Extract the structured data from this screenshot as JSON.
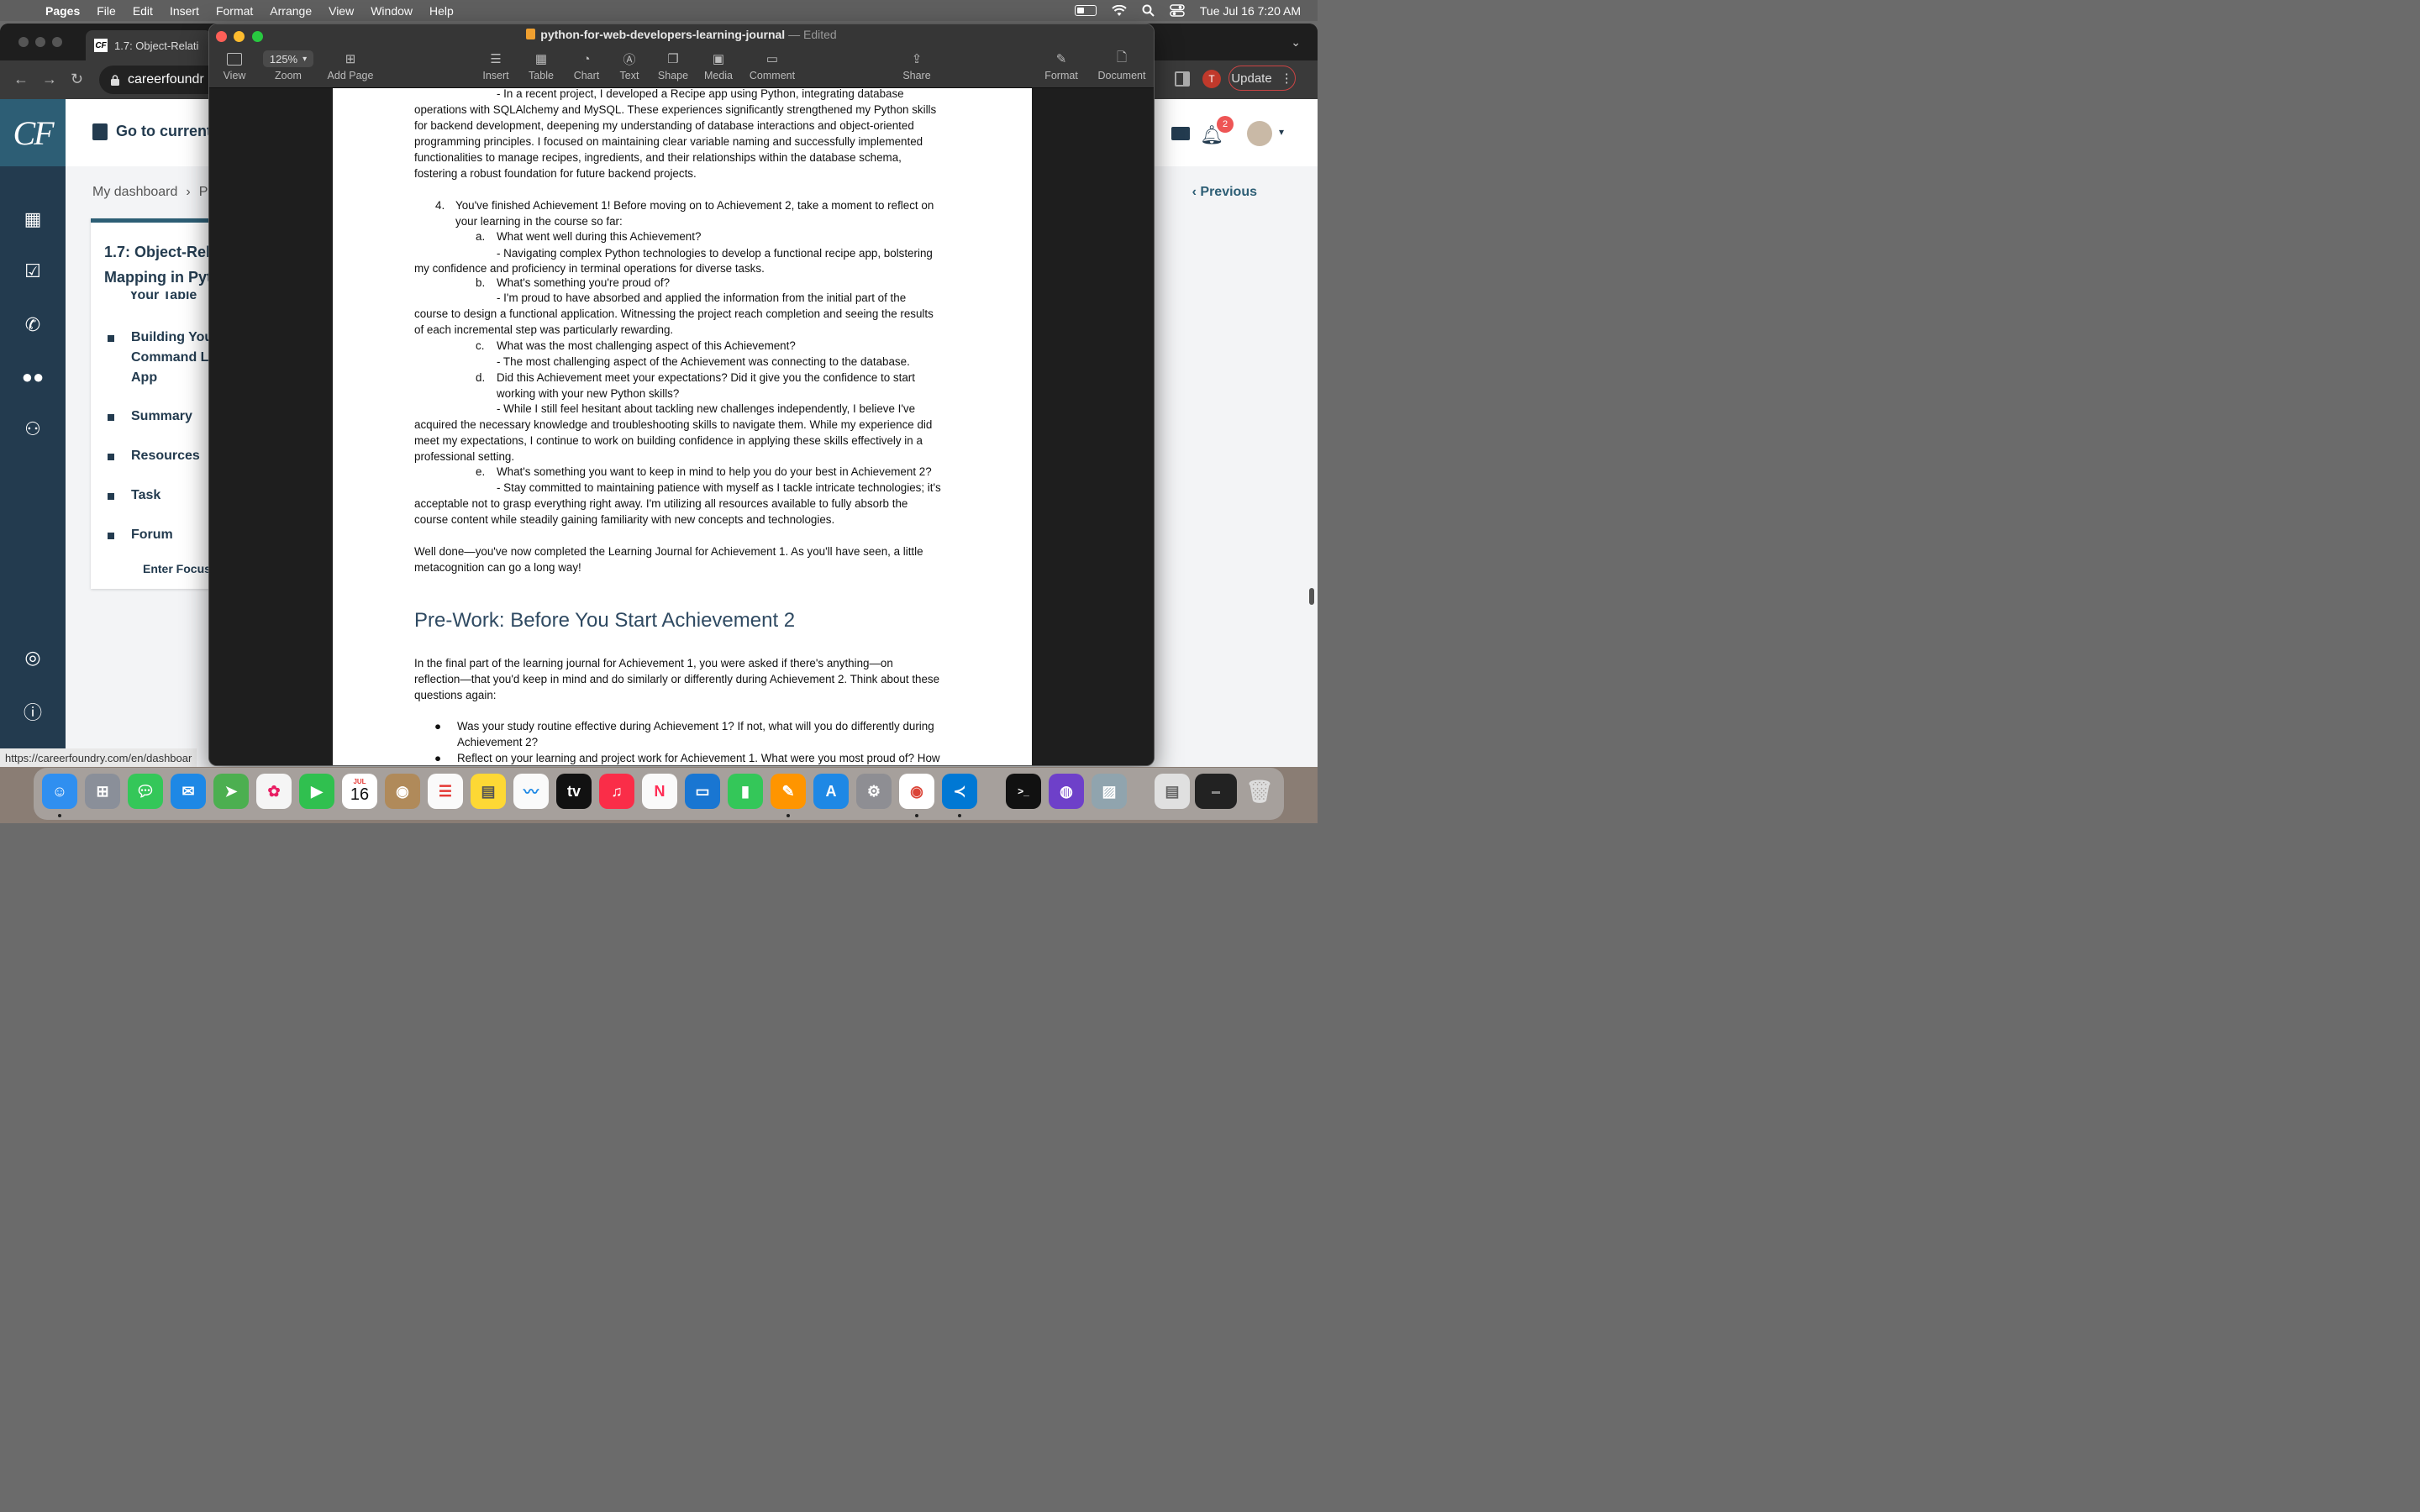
{
  "menubar": {
    "app": "Pages",
    "items": [
      "File",
      "Edit",
      "Insert",
      "Format",
      "Arrange",
      "View",
      "Window",
      "Help"
    ],
    "clock": "Tue Jul 16  7:20 AM"
  },
  "browser": {
    "tab_title": "1.7: Object-Relati",
    "url": "careerfoundr",
    "update_label": "Update",
    "avatar_initial": "T",
    "status_url": "https://careerfoundry.com/en/dashboar",
    "logo": "CF",
    "go_current": "Go to current",
    "notif_count": "2",
    "breadcrumb_root": "My dashboard",
    "breadcrumb_next": "P",
    "previous_label": "Previous",
    "card_title_1": "1.7: Object-Rela",
    "card_title_2": "Mapping in Pyth",
    "toc_cut": "Your Table",
    "toc": [
      {
        "label": "Building Your"
      },
      {
        "label": "Command Lin"
      },
      {
        "label": "App"
      },
      {
        "label": "Summary"
      },
      {
        "label": "Resources"
      },
      {
        "label": "Task"
      },
      {
        "label": "Forum"
      }
    ],
    "focus_label": "Enter Focus"
  },
  "pages": {
    "doc_name": "python-for-web-developers-learning-journal",
    "doc_status": "Edited",
    "toolbar": {
      "view": "View",
      "zoom_value": "125%",
      "zoom": "Zoom",
      "add_page": "Add Page",
      "insert": "Insert",
      "table": "Table",
      "chart": "Chart",
      "text": "Text",
      "shape": "Shape",
      "media": "Media",
      "comment": "Comment",
      "share": "Share",
      "format": "Format",
      "document": "Document"
    },
    "lines": {
      "l1": "- In a recent project, I developed a Recipe app using Python, integrating database",
      "l2": "operations with SQLAlchemy and MySQL. These experiences significantly strengthened my Python skills",
      "l3": "for backend development, deepening my understanding of database interactions and object-oriented",
      "l4": "programming principles. I focused on maintaining clear variable naming and successfully implemented",
      "l5": "functionalities to manage recipes, ingredients, and their relationships within the database schema,",
      "l6": "fostering a robust foundation for future backend projects.",
      "q4_num": "4.",
      "q4a": "You've finished Achievement 1! Before moving on to Achievement 2, take a moment to reflect on",
      "q4b": "your learning in the course so far:",
      "a_lbl": "a.",
      "a_q": "What went well during this Achievement?",
      "a1": "- Navigating complex Python technologies to develop a functional recipe app, bolstering",
      "a2": "my confidence and proficiency in terminal operations for diverse tasks.",
      "b_lbl": "b.",
      "b_q": "What's something you're proud of?",
      "b1": "- I'm proud to have absorbed and applied the information from the initial part of the",
      "b2": "course to design a functional application. Witnessing the project reach completion and seeing the results",
      "b3": "of each incremental step was particularly rewarding.",
      "c_lbl": "c.",
      "c_q": "What was the most challenging aspect of this Achievement?",
      "c1": "- The most challenging aspect of the Achievement was connecting to the database.",
      "d_lbl": "d.",
      "d_q1": "Did this Achievement meet your expectations? Did it give you the confidence to start",
      "d_q2": "working with your new Python skills?",
      "d1": "- While I still feel hesitant about tackling new challenges independently, I believe I've",
      "d2": "acquired the necessary knowledge and troubleshooting skills to navigate them. While my experience did",
      "d3": "meet my expectations, I continue to work on building confidence in applying these skills effectively in a",
      "d4": "professional setting.",
      "e_lbl": "e.",
      "e_q": "What's something you want to keep in mind to help you do your best in Achievement 2?",
      "e1": "- Stay committed to maintaining patience with myself as I tackle intricate technologies; it's",
      "e2": "acceptable not to grasp everything right away. I'm utilizing all resources available to fully absorb the",
      "e3": "course content while steadily gaining familiarity with new concepts and technologies.",
      "wd1": "Well done—you've now completed the Learning Journal for Achievement 1. As you'll have seen, a little",
      "wd2": "metacognition can go a long way!",
      "heading": "Pre-Work: Before You Start Achievement 2",
      "p1": "In the final part of the learning journal for Achievement 1, you were asked if there's anything—on",
      "p2": "reflection—that you'd keep in mind and do similarly or differently during Achievement 2. Think about these",
      "p3": "questions again:",
      "bullet1a": "Was your study routine effective during Achievement 1? If not, what will you do differently during",
      "bullet1b": "Achievement 2?",
      "bullet2": "Reflect on your learning and project work for Achievement 1. What were you most proud of? How"
    }
  },
  "dock": {
    "calendar_month": "JUL",
    "calendar_day": "16",
    "apps": [
      "finder-icon",
      "launchpad-icon",
      "messages-icon",
      "mail-icon",
      "maps-icon",
      "photos-icon",
      "facetime-icon",
      "calendar-icon",
      "contacts-icon",
      "reminders-icon",
      "notes-icon",
      "freeform-icon",
      "tv-icon",
      "music-icon",
      "news-icon",
      "keynote-icon",
      "numbers-icon",
      "pages-icon",
      "app-store-icon",
      "system-settings-icon",
      "chrome-icon",
      "vscode-icon",
      "terminal-icon",
      "github-desktop-icon",
      "preview-icon",
      "document-icon",
      "screenshot-icon",
      "trash-icon"
    ]
  },
  "colors": {
    "cf_navy": "#233b4f",
    "cf_teal": "#2d5e75",
    "heading_blue": "#2f4a62",
    "notif_red": "#e55555"
  }
}
